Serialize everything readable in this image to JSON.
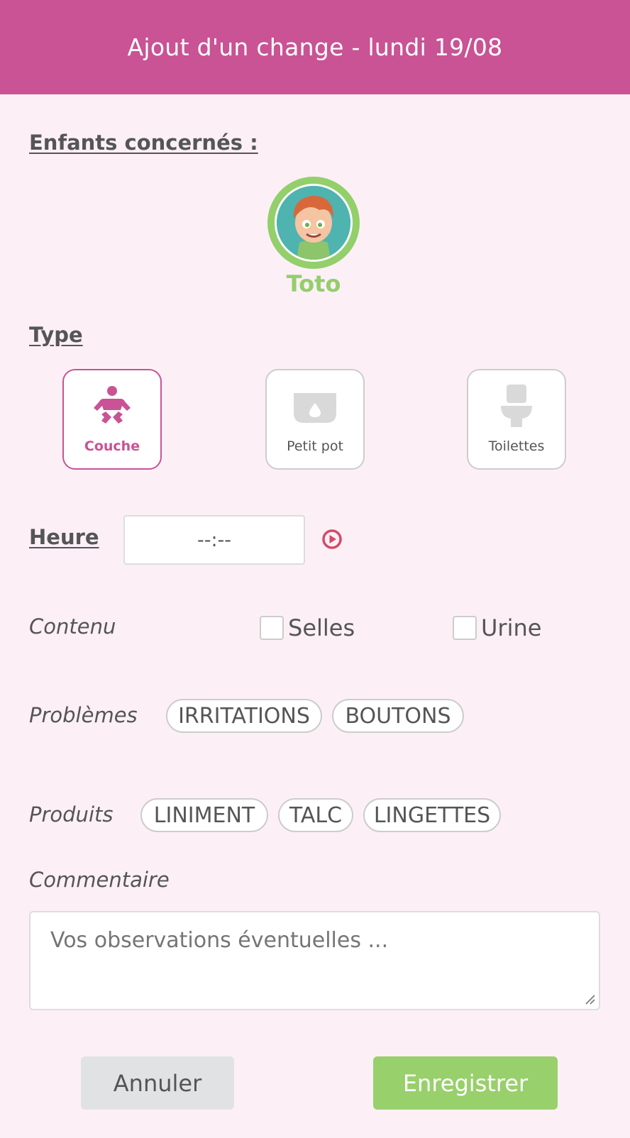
{
  "header": {
    "title": "Ajout d'un change - lundi 19/08"
  },
  "children": {
    "label": "Enfants concernés :",
    "items": [
      {
        "name": "Toto"
      }
    ]
  },
  "type": {
    "label": "Type",
    "options": [
      {
        "label": "Couche",
        "icon": "baby-icon",
        "selected": true
      },
      {
        "label": "Petit pot",
        "icon": "potty-icon",
        "selected": false
      },
      {
        "label": "Toilettes",
        "icon": "toilet-icon",
        "selected": false
      }
    ]
  },
  "time": {
    "label": "Heure",
    "value": "--:--"
  },
  "content": {
    "label": "Contenu",
    "options": [
      {
        "label": "Selles",
        "checked": false
      },
      {
        "label": "Urine",
        "checked": false
      }
    ]
  },
  "problems": {
    "label": "Problèmes",
    "chips": [
      "IRRITATIONS",
      "BOUTONS"
    ]
  },
  "products": {
    "label": "Produits",
    "chips": [
      "LINIMENT",
      "TALC",
      "LINGETTES"
    ]
  },
  "comment": {
    "label": "Commentaire",
    "placeholder": "Vos observations éventuelles ...",
    "value": ""
  },
  "actions": {
    "cancel": "Annuler",
    "save": "Enregistrer"
  },
  "colors": {
    "brand": "#c95394",
    "accent_green": "#98d06b",
    "background": "#fcf0f6",
    "play": "#d34b67"
  }
}
